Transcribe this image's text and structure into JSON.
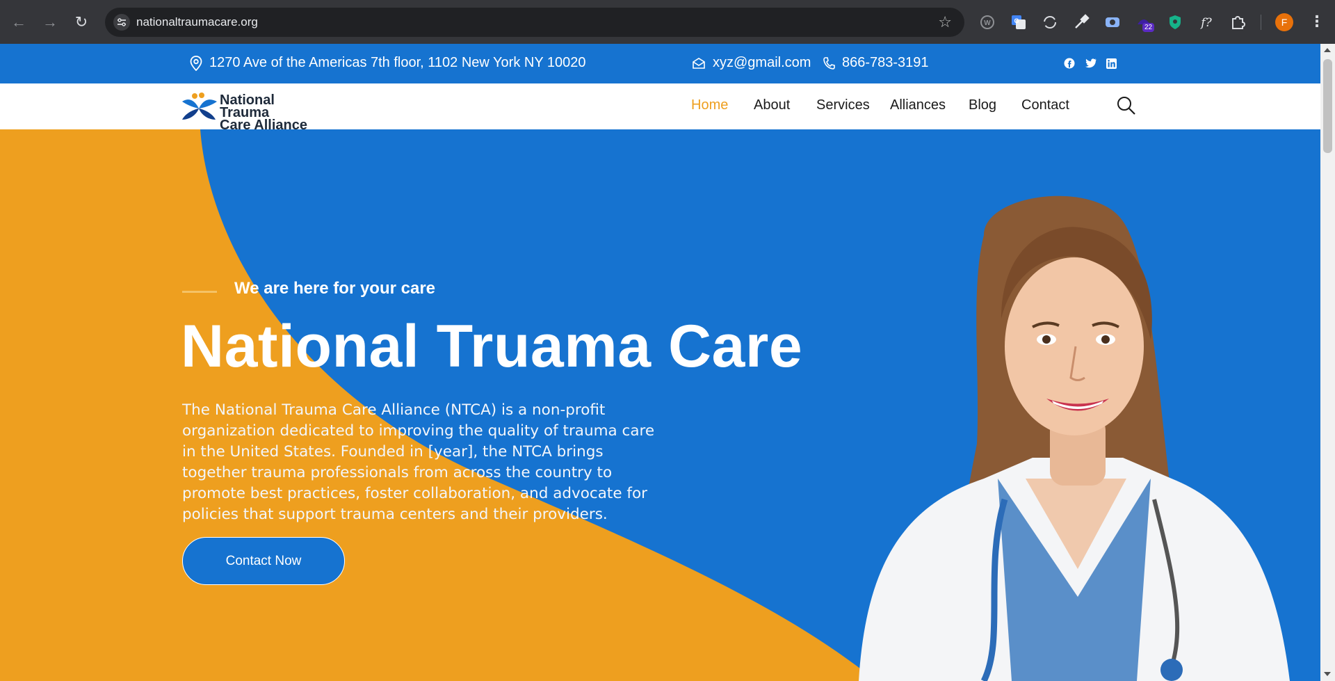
{
  "browser": {
    "url": "nationaltraumacare.org",
    "profile_initial": "F",
    "extension_badge": "22",
    "icons": [
      "back-arrow-icon",
      "forward-arrow-icon",
      "reload-icon",
      "site-settings-icon",
      "bookmark-star-icon",
      "extensions-puzzle-icon",
      "menu-kebab-icon"
    ]
  },
  "topbar": {
    "address": "1270 Ave of the Americas 7th floor, 1102 New York NY 10020",
    "email": "xyz@gmail.com",
    "phone": "866-783-3191",
    "social_icons": [
      "facebook-icon",
      "twitter-icon",
      "linkedin-icon"
    ],
    "bg_color": "#1673d0"
  },
  "header": {
    "logo_line1": "National Trauma",
    "logo_line2": "Care Alliance",
    "menu": [
      "Home",
      "About",
      "Services",
      "Alliances",
      "Blog",
      "Contact"
    ],
    "active_menu": "Home",
    "active_color": "#ee9f1f"
  },
  "hero": {
    "tagline": "We are here for your care",
    "title": "National Truama Care",
    "description": "The National Trauma Care Alliance (NTCA) is a non-profit organization dedicated to improving the quality of trauma care in the United States. Founded in [year], the NTCA brings together trauma professionals from across the country to promote best practices, foster collaboration, and advocate for policies that support trauma centers and their providers.",
    "cta_label": "Contact Now",
    "colors": {
      "orange": "#ee9f1f",
      "blue": "#1673d0"
    }
  }
}
